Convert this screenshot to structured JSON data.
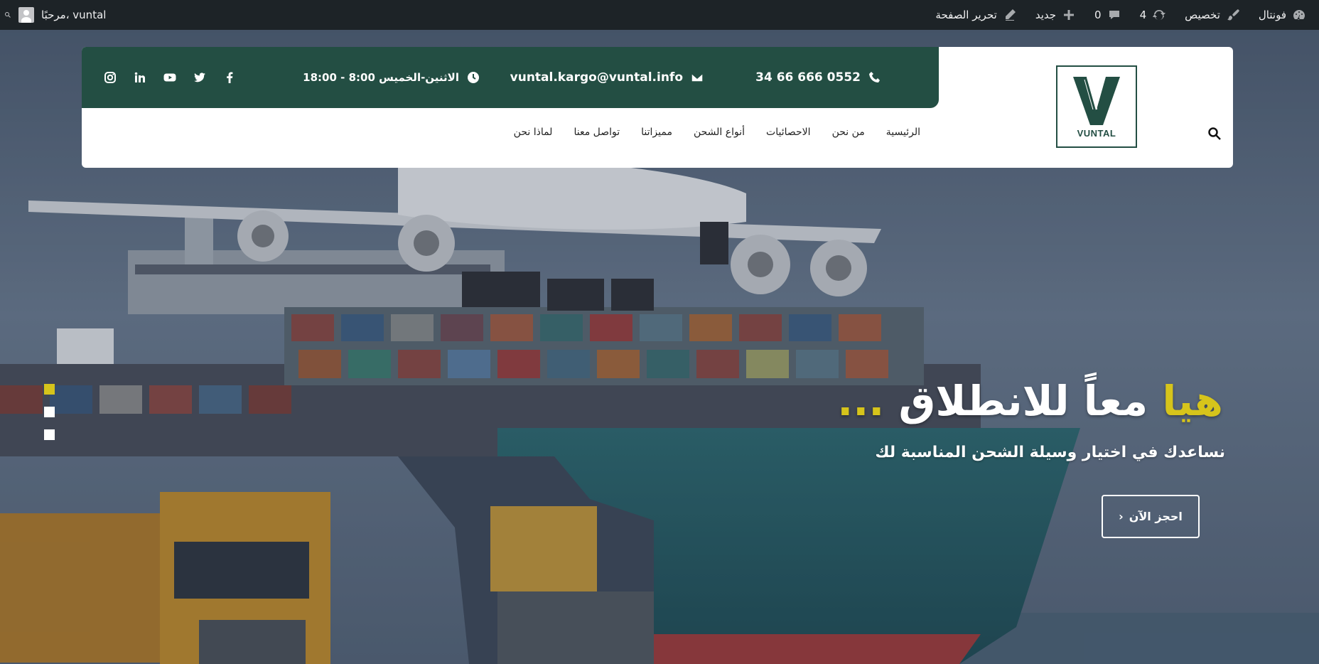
{
  "admin_bar": {
    "site_name": "فونتال",
    "customize": "تخصيص",
    "updates_count": "4",
    "comments_count": "0",
    "new_label": "جديد",
    "edit_page": "تحرير الصفحة",
    "greeting": "مرحبًا، vuntal"
  },
  "topbar": {
    "phone": "34 66 666 0552",
    "email": "vuntal.kargo@vuntal.info",
    "hours": "الاثنين-الخميس 8:00 - 18:00",
    "social": [
      "facebook-icon",
      "twitter-icon",
      "youtube-icon",
      "linkedin-icon",
      "instagram-icon"
    ]
  },
  "logo": {
    "text": "VUNTAL"
  },
  "nav": {
    "items": [
      "الرئيسية",
      "من نحن",
      "الاحصائيات",
      "أنواع الشحن",
      "مميزاتنا",
      "تواصل معنا",
      "لماذا نحن"
    ]
  },
  "hero": {
    "title_accent": "هيا",
    "title_main": "معاً للانطلاق",
    "title_dots": "...",
    "subtitle": "نساعدك في اختيار وسيلة الشحن المناسبة لك",
    "button": "احجز الآن"
  },
  "colors": {
    "brand_green": "#234e43",
    "accent_yellow": "#d6c41b",
    "admin_bar": "#1d2327"
  }
}
